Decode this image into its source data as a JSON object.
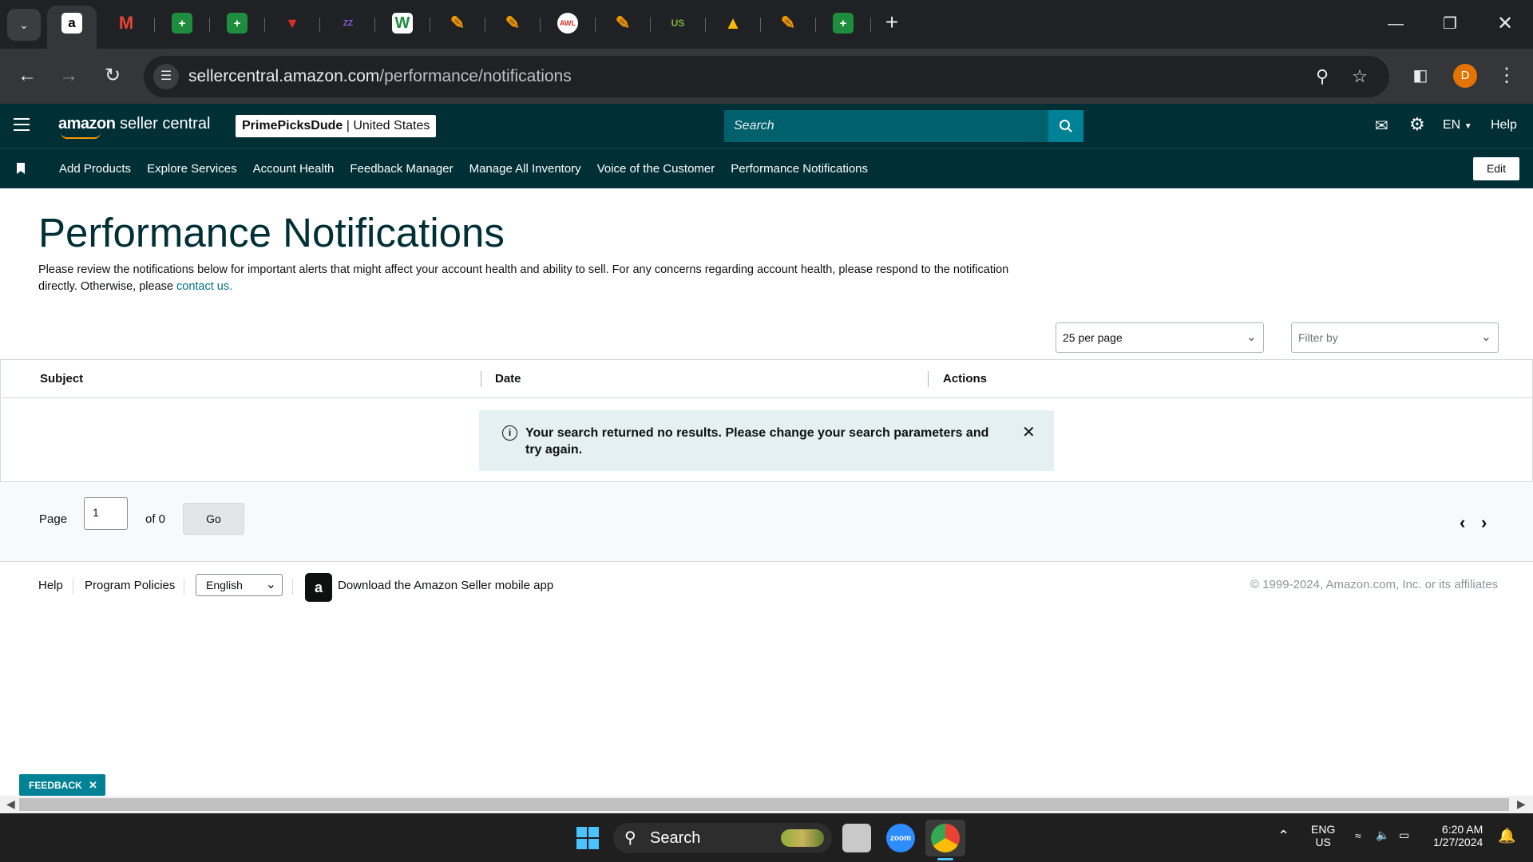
{
  "browser": {
    "url_domain": "sellercentral.amazon.com",
    "url_path": "/performance/notifications",
    "profile_initial": "D",
    "tabs": [
      {
        "icon": "amazon-icon",
        "active": true
      },
      {
        "icon": "gmail-icon"
      },
      {
        "icon": "sheets-icon"
      },
      {
        "icon": "sheets-icon"
      },
      {
        "icon": "red-logo-icon"
      },
      {
        "icon": "colorful-logo-icon"
      },
      {
        "icon": "w-logo-icon"
      },
      {
        "icon": "orange-pencil-icon"
      },
      {
        "icon": "orange-pencil-icon"
      },
      {
        "icon": "circle-logo-icon"
      },
      {
        "icon": "orange-pencil-icon"
      },
      {
        "icon": "us-foods-icon"
      },
      {
        "icon": "google-drive-icon"
      },
      {
        "icon": "orange-pencil-icon"
      },
      {
        "icon": "sheets-icon"
      }
    ]
  },
  "header": {
    "logo_text_bold": "amazon",
    "logo_text": " seller central",
    "store_name": "PrimePicksDude",
    "store_region": "United States",
    "search_placeholder": "Search",
    "language": "EN",
    "help": "Help"
  },
  "nav": {
    "links": [
      "Add Products",
      "Explore Services",
      "Account Health",
      "Feedback Manager",
      "Manage All Inventory",
      "Voice of the Customer",
      "Performance Notifications"
    ],
    "edit_label": "Edit"
  },
  "main": {
    "title": "Performance Notifications",
    "intro_text": "Please review the notifications below for important alerts that might affect your account health and ability to sell. For any concerns regarding account health, please respond to the notification directly. Otherwise, please ",
    "intro_link": "contact us.",
    "per_page": "25 per page",
    "filter_placeholder": "Filter by",
    "columns": [
      "Subject",
      "Date",
      "Actions"
    ],
    "alert_text": "Your search returned no results. Please change your search parameters and try again."
  },
  "pager": {
    "page_label": "Page",
    "page_value": "1",
    "of_label": "of 0",
    "go_label": "Go"
  },
  "footer": {
    "help": "Help",
    "policies": "Program Policies",
    "language": "English",
    "app_text": "Download the Amazon Seller mobile app",
    "copyright": "© 1999-2024, Amazon.com, Inc. or its affiliates"
  },
  "feedback_label": "FEEDBACK",
  "taskbar": {
    "search_label": "Search",
    "lang_top": "ENG",
    "lang_bottom": "US",
    "time": "6:20 AM",
    "date": "1/27/2024"
  },
  "colors": {
    "header_bg": "#002f36",
    "search_bg": "#00616d",
    "search_button": "#008296",
    "alert_bg": "#e4f0f2",
    "link": "#007185"
  }
}
